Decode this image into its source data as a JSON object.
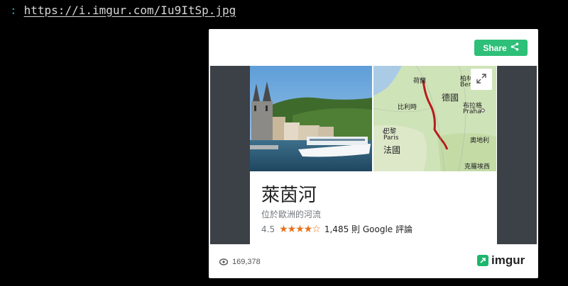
{
  "terminal": {
    "prompt": ":",
    "url": "https://i.imgur.com/Iu9ItSp.jpg"
  },
  "embed": {
    "share_label": "Share",
    "views": "169,378",
    "brand": "imgur"
  },
  "knowledge_panel": {
    "title": "萊茵河",
    "subtitle": "位於歐洲的河流",
    "rating": "4.5",
    "stars": "★★★★☆",
    "reviews": "1,485 則 Google 評論",
    "map_labels": {
      "netherlands": "荷蘭",
      "berlin_zh": "柏林",
      "berlin": "Berlin",
      "belgium": "比利時",
      "germany": "德國",
      "prague_zh": "布拉格",
      "prague": "Praha",
      "paris_zh": "巴黎",
      "paris": "Paris",
      "france": "法國",
      "austria": "奧地利",
      "croatia": "克羅埃西"
    }
  },
  "colors": {
    "share_green": "#2ebf78",
    "imgur_green": "#1bb76e",
    "side_bar": "#3c4047",
    "star_orange": "#e7711b",
    "rhine_red": "#b71c1c"
  }
}
